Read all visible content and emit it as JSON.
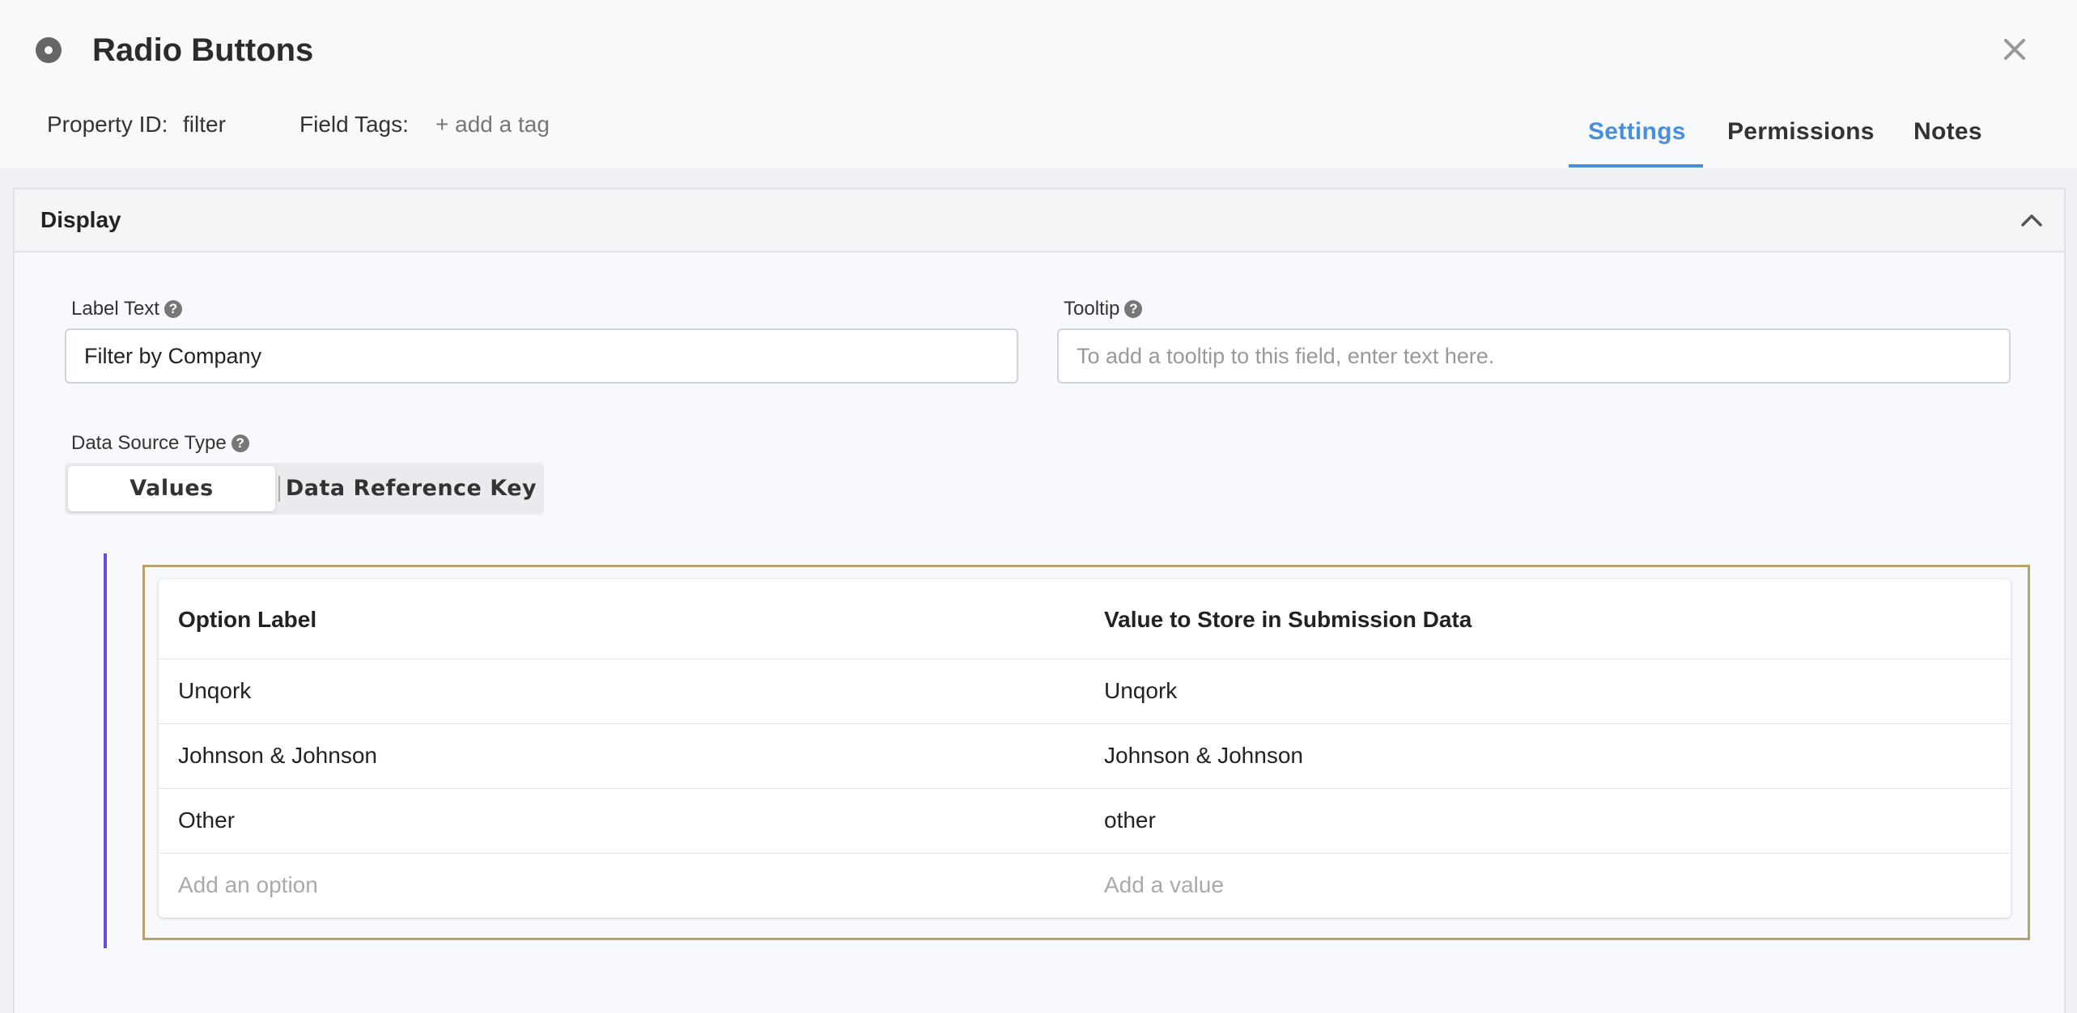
{
  "header": {
    "title": "Radio Buttons",
    "property_id_label": "Property ID:",
    "property_id_value": "filter",
    "field_tags_label": "Field Tags:",
    "add_tag": "+ add a tag",
    "tabs": [
      {
        "label": "Settings",
        "active": true
      },
      {
        "label": "Permissions",
        "active": false
      },
      {
        "label": "Notes",
        "active": false
      }
    ],
    "accent_color": "#4a8fd9"
  },
  "display": {
    "section_title": "Display",
    "label_text": {
      "label": "Label Text",
      "value": "Filter by Company"
    },
    "tooltip": {
      "label": "Tooltip",
      "placeholder": "To add a tooltip to this field, enter text here."
    },
    "data_source_type": {
      "label": "Data Source Type",
      "options": [
        "Values",
        "Data Reference Key"
      ],
      "selected": "Values"
    },
    "options_table": {
      "headers": [
        "Option Label",
        "Value to Store in Submission Data"
      ],
      "rows": [
        {
          "label": "Unqork",
          "value": "Unqork"
        },
        {
          "label": "Johnson & Johnson",
          "value": "Johnson & Johnson"
        },
        {
          "label": "Other",
          "value": "other"
        }
      ],
      "add_option_placeholder": "Add an option",
      "add_value_placeholder": "Add a value"
    }
  }
}
